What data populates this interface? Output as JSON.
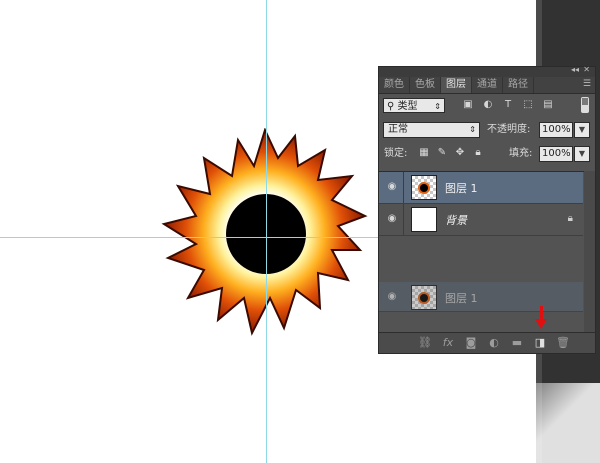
{
  "panel": {
    "tabs": [
      "颜色",
      "色板",
      "图层",
      "通道",
      "路径"
    ],
    "filter": {
      "label": "类型",
      "search_icon": "search-icon",
      "arrow": "⇕"
    },
    "blend_mode": "正常",
    "opacity_label": "不透明度:",
    "opacity_value": "100%",
    "lock_label": "锁定:",
    "fill_label": "填充:",
    "fill_value": "100%",
    "layers": [
      {
        "name": "图层 1",
        "selected": true,
        "thumb": "checker"
      },
      {
        "name": "背景",
        "selected": false,
        "thumb": "white",
        "locked": true
      }
    ],
    "ghost_layer": {
      "name": "图层 1"
    }
  },
  "colors": {
    "guide": "#8fd8e6",
    "selection": "#5b6b80",
    "panel_bg": "#535353",
    "arrow": "#e01010"
  }
}
